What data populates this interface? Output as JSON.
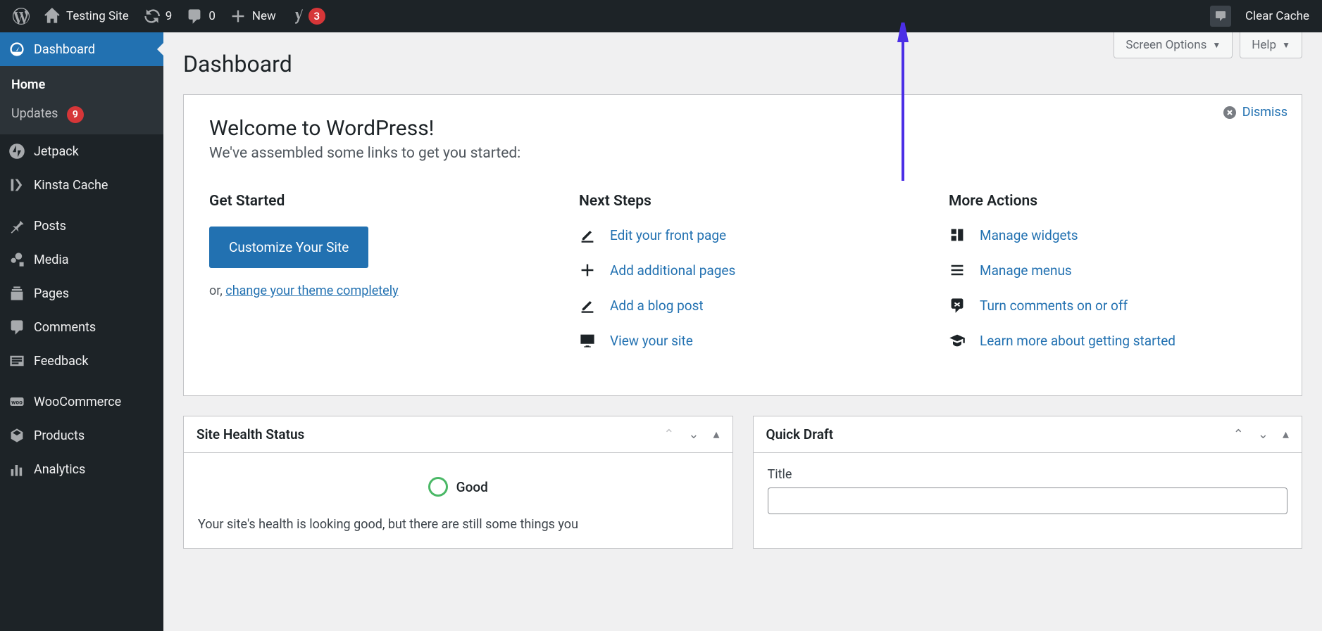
{
  "adminBar": {
    "siteName": "Testing Site",
    "updatesCount": "9",
    "commentsCount": "0",
    "newLabel": "New",
    "yoastCount": "3",
    "clearCache": "Clear Cache"
  },
  "sidebar": {
    "dashboard": "Dashboard",
    "home": "Home",
    "updates": "Updates",
    "updatesCount": "9",
    "jetpack": "Jetpack",
    "kinsta": "Kinsta Cache",
    "posts": "Posts",
    "media": "Media",
    "pages": "Pages",
    "comments": "Comments",
    "feedback": "Feedback",
    "woocommerce": "WooCommerce",
    "products": "Products",
    "analytics": "Analytics"
  },
  "screenOptions": "Screen Options",
  "help": "Help",
  "pageTitle": "Dashboard",
  "welcome": {
    "dismiss": "Dismiss",
    "title": "Welcome to WordPress!",
    "subtitle": "We've assembled some links to get you started:",
    "getStarted": "Get Started",
    "customizeBtn": "Customize Your Site",
    "orText": "or, ",
    "changeTheme": "change your theme completely",
    "nextSteps": "Next Steps",
    "editFront": "Edit your front page",
    "addPages": "Add additional pages",
    "addPost": "Add a blog post",
    "viewSite": "View your site",
    "moreActions": "More Actions",
    "manageWidgets": "Manage widgets",
    "manageMenus": "Manage menus",
    "comments": "Turn comments on or off",
    "learnMore": "Learn more about getting started"
  },
  "siteHealth": {
    "title": "Site Health Status",
    "status": "Good",
    "desc": "Your site's health is looking good, but there are still some things you"
  },
  "quickDraft": {
    "title": "Quick Draft",
    "titleLabel": "Title"
  }
}
